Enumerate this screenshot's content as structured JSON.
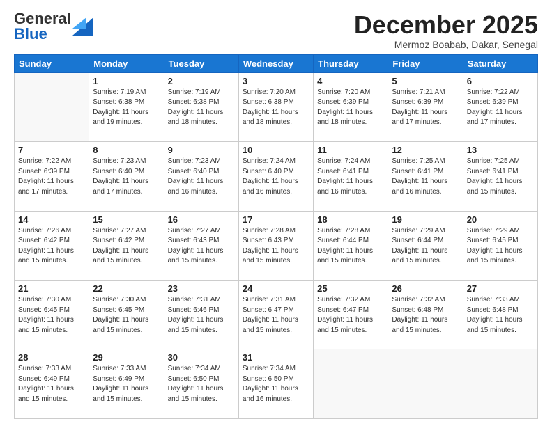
{
  "header": {
    "logo_general": "General",
    "logo_blue": "Blue",
    "month_title": "December 2025",
    "location": "Mermoz Boabab, Dakar, Senegal"
  },
  "weekdays": [
    "Sunday",
    "Monday",
    "Tuesday",
    "Wednesday",
    "Thursday",
    "Friday",
    "Saturday"
  ],
  "weeks": [
    [
      {
        "day": "",
        "empty": true
      },
      {
        "day": "1",
        "sunrise": "7:19 AM",
        "sunset": "6:38 PM",
        "daylight": "11 hours and 19 minutes."
      },
      {
        "day": "2",
        "sunrise": "7:19 AM",
        "sunset": "6:38 PM",
        "daylight": "11 hours and 18 minutes."
      },
      {
        "day": "3",
        "sunrise": "7:20 AM",
        "sunset": "6:38 PM",
        "daylight": "11 hours and 18 minutes."
      },
      {
        "day": "4",
        "sunrise": "7:20 AM",
        "sunset": "6:39 PM",
        "daylight": "11 hours and 18 minutes."
      },
      {
        "day": "5",
        "sunrise": "7:21 AM",
        "sunset": "6:39 PM",
        "daylight": "11 hours and 17 minutes."
      },
      {
        "day": "6",
        "sunrise": "7:22 AM",
        "sunset": "6:39 PM",
        "daylight": "11 hours and 17 minutes."
      }
    ],
    [
      {
        "day": "7",
        "sunrise": "7:22 AM",
        "sunset": "6:39 PM",
        "daylight": "11 hours and 17 minutes."
      },
      {
        "day": "8",
        "sunrise": "7:23 AM",
        "sunset": "6:40 PM",
        "daylight": "11 hours and 17 minutes."
      },
      {
        "day": "9",
        "sunrise": "7:23 AM",
        "sunset": "6:40 PM",
        "daylight": "11 hours and 16 minutes."
      },
      {
        "day": "10",
        "sunrise": "7:24 AM",
        "sunset": "6:40 PM",
        "daylight": "11 hours and 16 minutes."
      },
      {
        "day": "11",
        "sunrise": "7:24 AM",
        "sunset": "6:41 PM",
        "daylight": "11 hours and 16 minutes."
      },
      {
        "day": "12",
        "sunrise": "7:25 AM",
        "sunset": "6:41 PM",
        "daylight": "11 hours and 16 minutes."
      },
      {
        "day": "13",
        "sunrise": "7:25 AM",
        "sunset": "6:41 PM",
        "daylight": "11 hours and 15 minutes."
      }
    ],
    [
      {
        "day": "14",
        "sunrise": "7:26 AM",
        "sunset": "6:42 PM",
        "daylight": "11 hours and 15 minutes."
      },
      {
        "day": "15",
        "sunrise": "7:27 AM",
        "sunset": "6:42 PM",
        "daylight": "11 hours and 15 minutes."
      },
      {
        "day": "16",
        "sunrise": "7:27 AM",
        "sunset": "6:43 PM",
        "daylight": "11 hours and 15 minutes."
      },
      {
        "day": "17",
        "sunrise": "7:28 AM",
        "sunset": "6:43 PM",
        "daylight": "11 hours and 15 minutes."
      },
      {
        "day": "18",
        "sunrise": "7:28 AM",
        "sunset": "6:44 PM",
        "daylight": "11 hours and 15 minutes."
      },
      {
        "day": "19",
        "sunrise": "7:29 AM",
        "sunset": "6:44 PM",
        "daylight": "11 hours and 15 minutes."
      },
      {
        "day": "20",
        "sunrise": "7:29 AM",
        "sunset": "6:45 PM",
        "daylight": "11 hours and 15 minutes."
      }
    ],
    [
      {
        "day": "21",
        "sunrise": "7:30 AM",
        "sunset": "6:45 PM",
        "daylight": "11 hours and 15 minutes."
      },
      {
        "day": "22",
        "sunrise": "7:30 AM",
        "sunset": "6:45 PM",
        "daylight": "11 hours and 15 minutes."
      },
      {
        "day": "23",
        "sunrise": "7:31 AM",
        "sunset": "6:46 PM",
        "daylight": "11 hours and 15 minutes."
      },
      {
        "day": "24",
        "sunrise": "7:31 AM",
        "sunset": "6:47 PM",
        "daylight": "11 hours and 15 minutes."
      },
      {
        "day": "25",
        "sunrise": "7:32 AM",
        "sunset": "6:47 PM",
        "daylight": "11 hours and 15 minutes."
      },
      {
        "day": "26",
        "sunrise": "7:32 AM",
        "sunset": "6:48 PM",
        "daylight": "11 hours and 15 minutes."
      },
      {
        "day": "27",
        "sunrise": "7:33 AM",
        "sunset": "6:48 PM",
        "daylight": "11 hours and 15 minutes."
      }
    ],
    [
      {
        "day": "28",
        "sunrise": "7:33 AM",
        "sunset": "6:49 PM",
        "daylight": "11 hours and 15 minutes."
      },
      {
        "day": "29",
        "sunrise": "7:33 AM",
        "sunset": "6:49 PM",
        "daylight": "11 hours and 15 minutes."
      },
      {
        "day": "30",
        "sunrise": "7:34 AM",
        "sunset": "6:50 PM",
        "daylight": "11 hours and 15 minutes."
      },
      {
        "day": "31",
        "sunrise": "7:34 AM",
        "sunset": "6:50 PM",
        "daylight": "11 hours and 16 minutes."
      },
      {
        "day": "",
        "empty": true
      },
      {
        "day": "",
        "empty": true
      },
      {
        "day": "",
        "empty": true
      }
    ]
  ]
}
